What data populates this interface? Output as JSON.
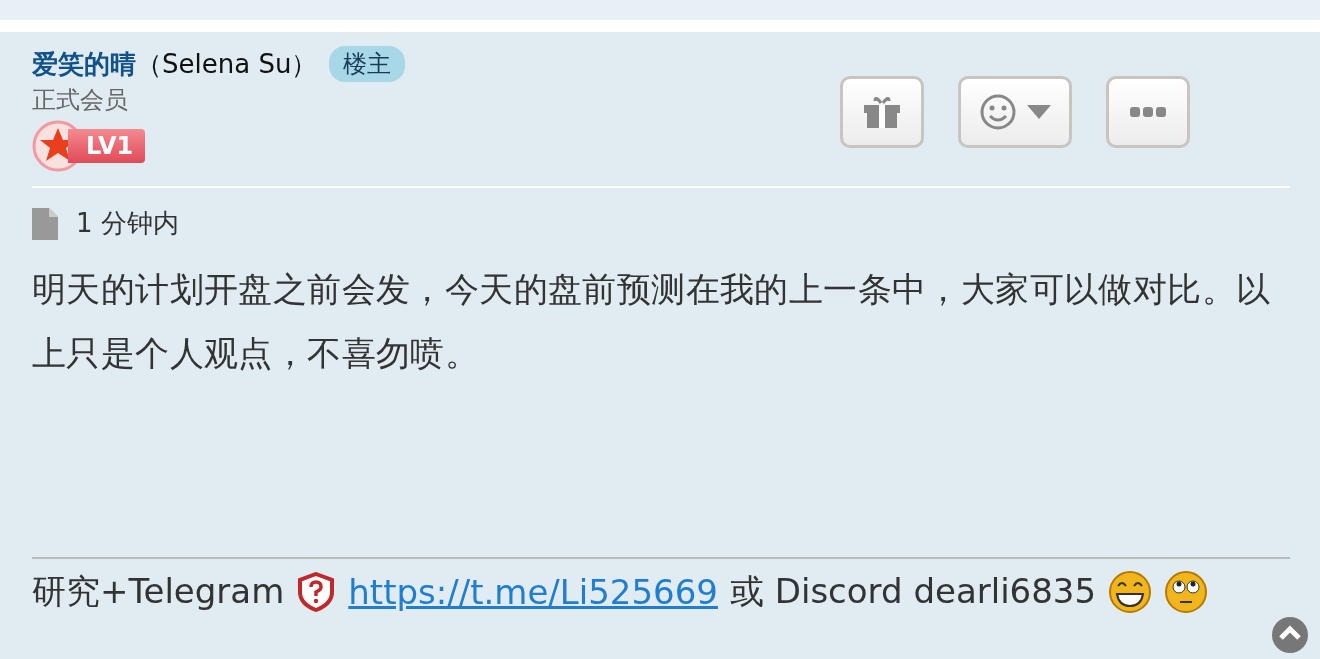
{
  "author": {
    "name": "爱笑的晴",
    "alias": "（Selena Su）",
    "badge": "楼主",
    "role": "正式会员",
    "level": "LV1"
  },
  "actions": [
    {
      "kind": "gift"
    },
    {
      "kind": "emoji"
    },
    {
      "kind": "more"
    }
  ],
  "post": {
    "time": "1 分钟内",
    "body": "明天的计划开盘之前会发，今天的盘前预测在我的上一条中，大家可以做对比。以上只是个人观点，不喜勿喷。"
  },
  "signature": {
    "text_before": "研究+Telegram",
    "link": "https://t.me/Li525669",
    "text_after": "或 Discord dearli6835"
  }
}
